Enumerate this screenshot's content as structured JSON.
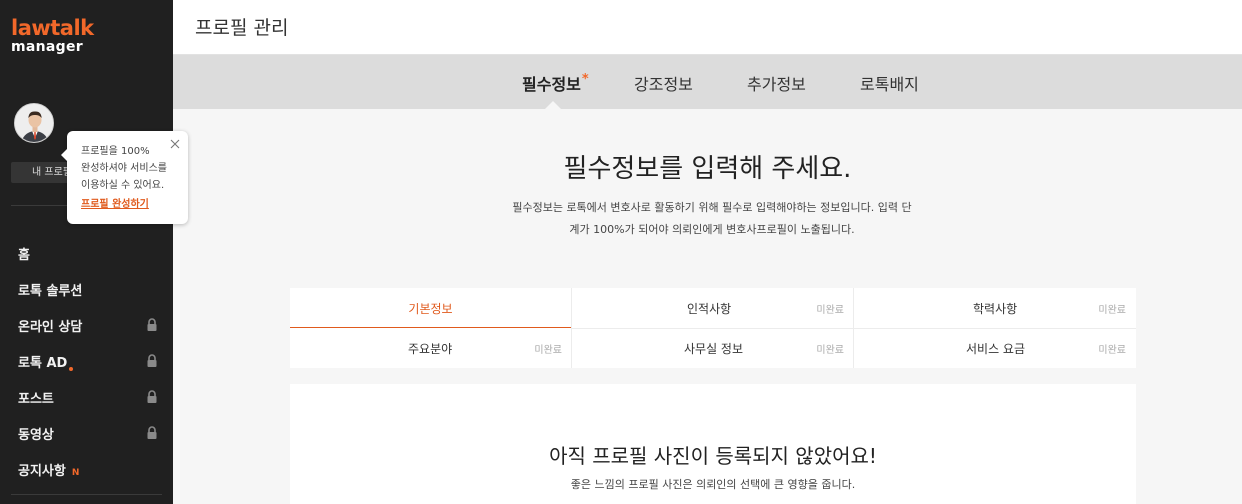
{
  "brand": {
    "line1": "lawtalk",
    "line2": "manager",
    "accent": "#f2682a"
  },
  "sidebar": {
    "profile_button": "내 프로필",
    "menu": [
      {
        "label": "홈",
        "locked": false
      },
      {
        "label": "로톡 솔루션",
        "locked": false
      },
      {
        "label": "온라인 상담",
        "locked": true
      },
      {
        "label": "로톡 AD",
        "locked": true,
        "dot": true
      },
      {
        "label": "포스트",
        "locked": true
      },
      {
        "label": "동영상",
        "locked": true
      },
      {
        "label": "공지사항",
        "locked": false,
        "badge": "N"
      }
    ]
  },
  "tooltip": {
    "line1": "프로필을 100%",
    "line2": "완성하셔야 서비스를",
    "line3": "이용하실 수 있어요.",
    "link": "프로필 완성하기"
  },
  "header": {
    "title": "프로필 관리"
  },
  "tabs": [
    {
      "label": "필수정보",
      "active": true,
      "required": "*"
    },
    {
      "label": "강조정보"
    },
    {
      "label": "추가정보"
    },
    {
      "label": "로톡배지"
    }
  ],
  "main": {
    "heading": "필수정보를 입력해 주세요.",
    "description": "필수정보는 로톡에서 변호사로 활동하기 위해 필수로 입력해야하는 정보입니다. 입력 단계가 100%가 되어야 의뢰인에게 변호사프로필이 노출됩니다."
  },
  "sections": [
    {
      "name": "기본정보",
      "status": "",
      "active": true
    },
    {
      "name": "인적사항",
      "status": "미완료"
    },
    {
      "name": "학력사항",
      "status": "미완료"
    },
    {
      "name": "주요분야",
      "status": "미완료"
    },
    {
      "name": "사무실 정보",
      "status": "미완료"
    },
    {
      "name": "서비스 요금",
      "status": "미완료"
    }
  ],
  "photo_card": {
    "title": "아직 프로필 사진이 등록되지 않았어요!",
    "description": "좋은 느낌의 프로필 사진은 의뢰인의 선택에 큰 영향을 줍니다."
  }
}
